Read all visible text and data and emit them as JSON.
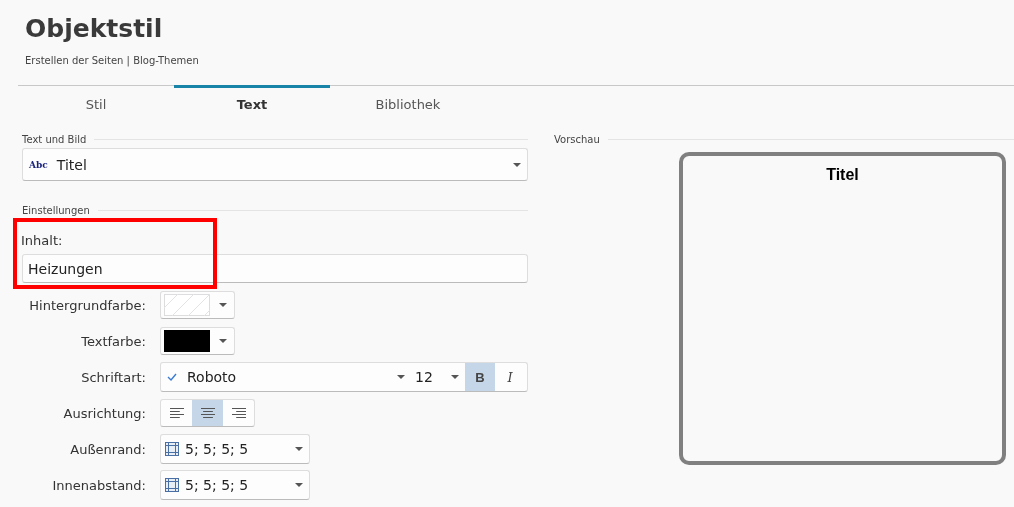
{
  "header": {
    "title": "Objektstil",
    "subtitle": "Erstellen der Seiten | Blog-Themen"
  },
  "tabs": [
    {
      "label": "Stil",
      "selected": false
    },
    {
      "label": "Text",
      "selected": true
    },
    {
      "label": "Bibliothek",
      "selected": false
    }
  ],
  "text_section": {
    "heading": "Text und Bild",
    "icon_text": "Abc",
    "value": "Titel"
  },
  "settings": {
    "heading": "Einstellungen",
    "content": {
      "label": "Inhalt:",
      "value": "Heizungen",
      "highlighted": true
    },
    "background": {
      "label": "Hintergrundfarbe:",
      "transparent": true
    },
    "text_color": {
      "label": "Textfarbe:",
      "color": "#000000"
    },
    "font": {
      "label": "Schriftart:",
      "name": "Roboto",
      "size": "12",
      "bold": true,
      "italic": false,
      "bold_label": "B",
      "italic_label": "I"
    },
    "alignment": {
      "label": "Ausrichtung:",
      "options": [
        {
          "kind": "left",
          "selected": false
        },
        {
          "kind": "center",
          "selected": true
        },
        {
          "kind": "right",
          "selected": false
        }
      ]
    },
    "margin": {
      "label": "Außenrand:",
      "value": "5; 5; 5; 5"
    },
    "padding": {
      "label": "Innenabstand:",
      "value": "5; 5; 5; 5"
    }
  },
  "preview": {
    "heading": "Vorschau",
    "title": "Titel"
  }
}
